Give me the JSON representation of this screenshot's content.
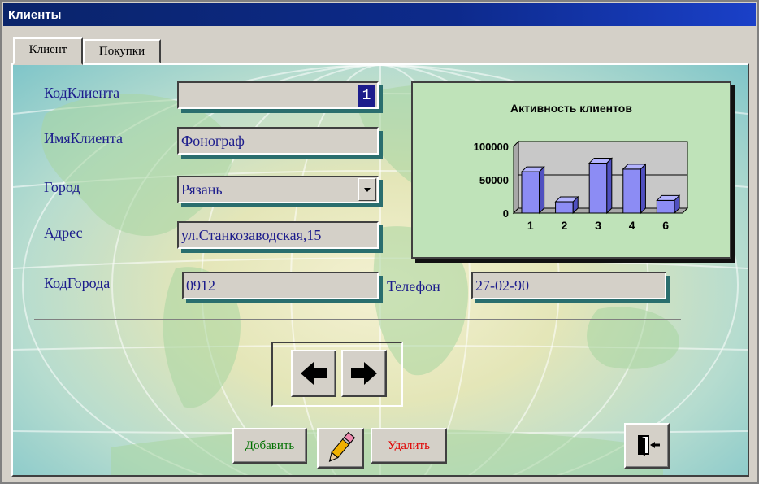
{
  "window": {
    "title": "Клиенты"
  },
  "tabs": [
    {
      "label": "Клиент",
      "active": true
    },
    {
      "label": "Покупки",
      "active": false
    }
  ],
  "form": {
    "client_id": {
      "label": "КодКлиента",
      "value": "1"
    },
    "client_name": {
      "label": "ИмяКлиента",
      "value": "Фонограф"
    },
    "city": {
      "label": "Город",
      "value": "Рязань"
    },
    "address": {
      "label": "Адрес",
      "value": "ул.Станкозаводская,15"
    },
    "city_code": {
      "label": "КодГорода",
      "value": "0912"
    },
    "phone": {
      "label": "Телефон",
      "value": "27-02-90"
    }
  },
  "chart_data": {
    "type": "bar",
    "title": "Активность клиентов",
    "categories": [
      "1",
      "2",
      "3",
      "4",
      "6"
    ],
    "values": [
      62000,
      17000,
      75000,
      66000,
      19000
    ],
    "ylim": [
      0,
      100000
    ],
    "yticks": [
      "100000",
      "50000",
      "0"
    ],
    "grid": true,
    "legend": "none",
    "bar_color": "#8c8cf4"
  },
  "buttons": {
    "prev_icon": "arrow-left-icon",
    "next_icon": "arrow-right-icon",
    "add_label": "Добавить",
    "edit_icon": "pencil-icon",
    "delete_label": "Удалить",
    "exit_icon": "exit-door-icon"
  },
  "colors": {
    "label_text": "#1c1c8c",
    "title_bar": "#0a246a",
    "add_text": "#007000",
    "delete_text": "#e00000"
  }
}
